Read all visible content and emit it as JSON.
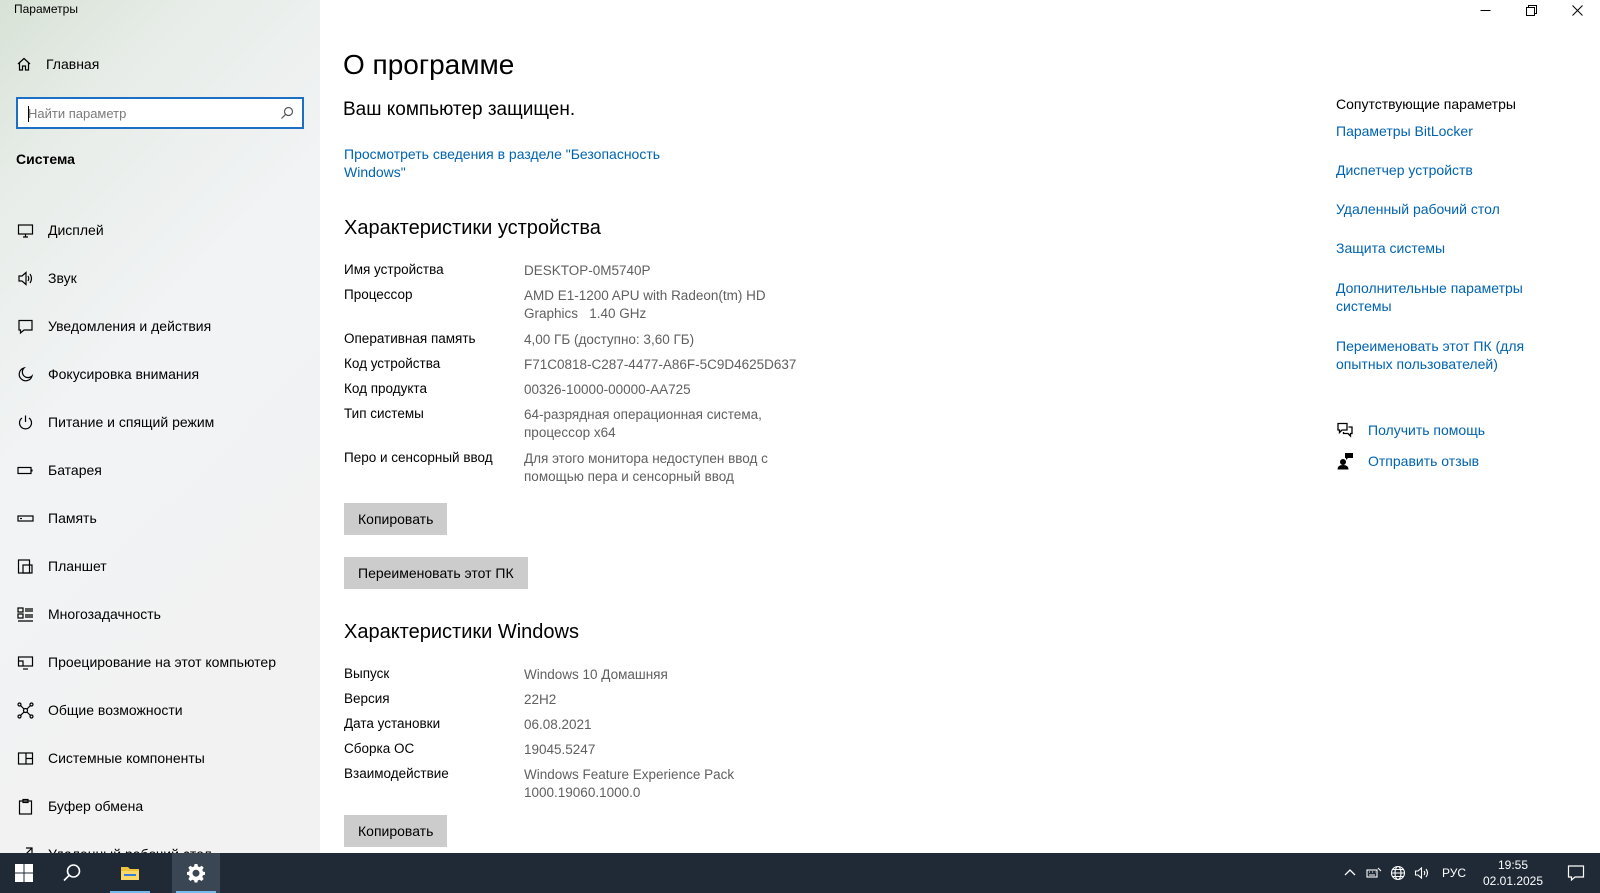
{
  "window": {
    "app_title": "Параметры"
  },
  "sidebar": {
    "home_label": "Главная",
    "search_placeholder": "Найти параметр",
    "section_label": "Система",
    "items": [
      {
        "label": "Дисплей",
        "icon": "display-icon"
      },
      {
        "label": "Звук",
        "icon": "sound-icon"
      },
      {
        "label": "Уведомления и действия",
        "icon": "notifications-icon"
      },
      {
        "label": "Фокусировка внимания",
        "icon": "focus-assist-icon"
      },
      {
        "label": "Питание и спящий режим",
        "icon": "power-icon"
      },
      {
        "label": "Батарея",
        "icon": "battery-icon"
      },
      {
        "label": "Память",
        "icon": "storage-icon"
      },
      {
        "label": "Планшет",
        "icon": "tablet-icon"
      },
      {
        "label": "Многозадачность",
        "icon": "multitasking-icon"
      },
      {
        "label": "Проецирование на этот компьютер",
        "icon": "projecting-icon"
      },
      {
        "label": "Общие возможности",
        "icon": "shared-experiences-icon"
      },
      {
        "label": "Системные компоненты",
        "icon": "system-components-icon"
      },
      {
        "label": "Буфер обмена",
        "icon": "clipboard-icon"
      },
      {
        "label": "Удаленный рабочий стол",
        "icon": "remote-desktop-icon"
      }
    ]
  },
  "main": {
    "title": "О программе",
    "protected_text": "Ваш компьютер защищен.",
    "security_link": "Просмотреть сведения в разделе \"Безопасность Windows\"",
    "device_heading": "Характеристики устройства",
    "device_specs": [
      {
        "label": "Имя устройства",
        "value": "DESKTOP-0M5740P"
      },
      {
        "label": "Процессор",
        "value": "AMD E1-1200 APU with Radeon(tm) HD Graphics   1.40 GHz"
      },
      {
        "label": "Оперативная память",
        "value": "4,00 ГБ (доступно: 3,60 ГБ)"
      },
      {
        "label": "Код устройства",
        "value": "F71C0818-C287-4477-A86F-5C9D4625D637"
      },
      {
        "label": "Код продукта",
        "value": "00326-10000-00000-AA725"
      },
      {
        "label": "Тип системы",
        "value": "64-разрядная операционная система, процессор x64"
      },
      {
        "label": "Перо и сенсорный ввод",
        "value": "Для этого монитора недоступен ввод с помощью пера и сенсорный ввод"
      }
    ],
    "copy_button": "Копировать",
    "rename_button": "Переименовать этот ПК",
    "windows_heading": "Характеристики Windows",
    "windows_specs": [
      {
        "label": "Выпуск",
        "value": "Windows 10 Домашняя"
      },
      {
        "label": "Версия",
        "value": "22H2"
      },
      {
        "label": "Дата установки",
        "value": "06.08.2021"
      },
      {
        "label": "Сборка ОС",
        "value": "19045.5247"
      },
      {
        "label": "Взаимодействие",
        "value": "Windows Feature Experience Pack 1000.19060.1000.0"
      }
    ],
    "copy_button_2": "Копировать"
  },
  "rail": {
    "title": "Сопутствующие параметры",
    "links": [
      "Параметры BitLocker",
      "Диспетчер устройств",
      "Удаленный рабочий стол",
      "Защита системы",
      "Дополнительные параметры системы",
      "Переименовать этот ПК (для опытных пользователей)"
    ],
    "help_label": "Получить помощь",
    "feedback_label": "Отправить отзыв"
  },
  "taskbar": {
    "lang": "РУС",
    "time": "19:55",
    "date": "02.01.2025"
  },
  "colors": {
    "accent": "#0063b1",
    "search_border": "#1d6fc4",
    "taskbar": "#1f2a36",
    "button": "#cccccc"
  }
}
